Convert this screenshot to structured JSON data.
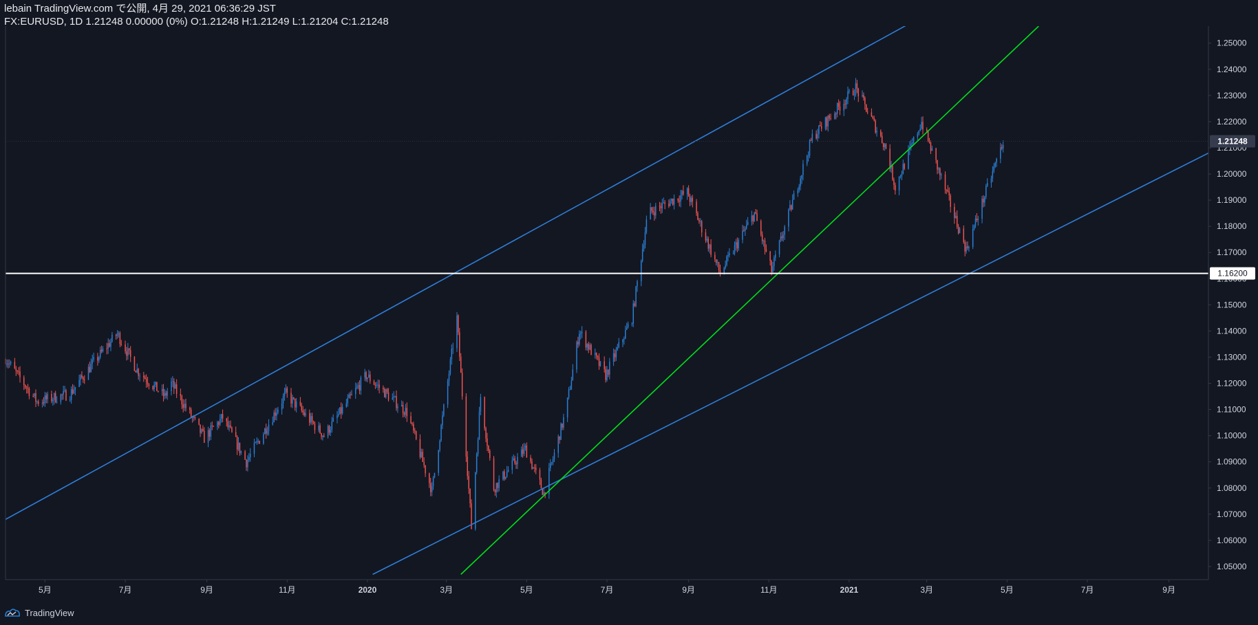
{
  "header": {
    "line1": "lebain TradingView.com で公開, 4月 29, 2021 06:36:29 JST",
    "line2": "FX:EURUSD, 1D 1.21248 0.00000 (0%) O:1.21248 H:1.21249 L:1.21204 C:1.21248"
  },
  "footer": {
    "brand": "TradingView"
  },
  "colors": {
    "background": "#131722",
    "up": "#2a7fd4",
    "down": "#ef5350",
    "channel": "#2f7ed8",
    "trend": "#00e01a",
    "level": "#ffffff",
    "axis_line": "#363a45"
  },
  "chart_data": {
    "type": "candlestick",
    "symbol": "FX:EURUSD",
    "interval": "1D",
    "ylim": [
      1.045,
      1.2565
    ],
    "y_ticks": [
      1.05,
      1.06,
      1.07,
      1.08,
      1.09,
      1.1,
      1.11,
      1.12,
      1.13,
      1.14,
      1.15,
      1.16,
      1.17,
      1.18,
      1.19,
      1.2,
      1.21,
      1.22,
      1.23,
      1.24,
      1.25
    ],
    "y_tick_labels": [
      "1.05000",
      "1.06000",
      "1.07000",
      "1.08000",
      "1.09000",
      "1.10000",
      "1.11000",
      "1.12000",
      "1.13000",
      "1.14000",
      "1.15000",
      "1.16000",
      "1.17000",
      "1.18000",
      "1.19000",
      "1.20000",
      "1.21000",
      "1.22000",
      "1.23000",
      "1.24000",
      "1.25000"
    ],
    "x_range": [
      "2019-04-01",
      "2021-10-01"
    ],
    "x_ticks": [
      {
        "date": "2019-05-01",
        "label": "5月",
        "bold": false
      },
      {
        "date": "2019-07-01",
        "label": "7月",
        "bold": false
      },
      {
        "date": "2019-09-01",
        "label": "9月",
        "bold": false
      },
      {
        "date": "2019-11-01",
        "label": "11月",
        "bold": false
      },
      {
        "date": "2020-01-01",
        "label": "2020",
        "bold": true
      },
      {
        "date": "2020-03-01",
        "label": "3月",
        "bold": false
      },
      {
        "date": "2020-05-01",
        "label": "5月",
        "bold": false
      },
      {
        "date": "2020-07-01",
        "label": "7月",
        "bold": false
      },
      {
        "date": "2020-09-01",
        "label": "9月",
        "bold": false
      },
      {
        "date": "2020-11-01",
        "label": "11月",
        "bold": false
      },
      {
        "date": "2021-01-01",
        "label": "2021",
        "bold": true
      },
      {
        "date": "2021-03-01",
        "label": "3月",
        "bold": false
      },
      {
        "date": "2021-05-01",
        "label": "5月",
        "bold": false
      },
      {
        "date": "2021-07-01",
        "label": "7月",
        "bold": false
      },
      {
        "date": "2021-09-01",
        "label": "9月",
        "bold": false
      }
    ],
    "price_path": [
      [
        "2019-04-01",
        1.1295
      ],
      [
        "2019-04-25",
        1.113
      ],
      [
        "2019-05-20",
        1.116
      ],
      [
        "2019-06-07",
        1.128
      ],
      [
        "2019-06-25",
        1.139
      ],
      [
        "2019-07-10",
        1.125
      ],
      [
        "2019-07-31",
        1.115
      ],
      [
        "2019-08-05",
        1.12
      ],
      [
        "2019-08-30",
        1.099
      ],
      [
        "2019-09-13",
        1.107
      ],
      [
        "2019-10-01",
        1.09
      ],
      [
        "2019-10-31",
        1.116
      ],
      [
        "2019-11-29",
        1.1
      ],
      [
        "2019-12-31",
        1.123
      ],
      [
        "2020-01-31",
        1.109
      ],
      [
        "2020-02-19",
        1.079
      ],
      [
        "2020-03-09",
        1.145
      ],
      [
        "2020-03-20",
        1.065
      ],
      [
        "2020-03-27",
        1.115
      ],
      [
        "2020-04-06",
        1.08
      ],
      [
        "2020-04-30",
        1.095
      ],
      [
        "2020-05-14",
        1.078
      ],
      [
        "2020-05-31",
        1.11
      ],
      [
        "2020-06-10",
        1.14
      ],
      [
        "2020-06-30",
        1.123
      ],
      [
        "2020-07-20",
        1.145
      ],
      [
        "2020-08-01",
        1.185
      ],
      [
        "2020-08-31",
        1.193
      ],
      [
        "2020-09-25",
        1.162
      ],
      [
        "2020-10-21",
        1.185
      ],
      [
        "2020-11-03",
        1.163
      ],
      [
        "2020-12-04",
        1.214
      ],
      [
        "2021-01-06",
        1.233
      ],
      [
        "2021-01-29",
        1.21
      ],
      [
        "2021-02-05",
        1.195
      ],
      [
        "2021-02-25",
        1.22
      ],
      [
        "2021-03-31",
        1.171
      ],
      [
        "2021-04-28",
        1.2125
      ]
    ],
    "last_price": {
      "value": 1.21248,
      "label": "1.21248"
    },
    "drawings": [
      {
        "name": "upper-channel-line",
        "color": "channel",
        "from": [
          "2019-04-01",
          1.068
        ],
        "to": [
          "2021-02-25",
          1.26
        ]
      },
      {
        "name": "lower-channel-line",
        "color": "channel",
        "from": [
          "2020-01-05",
          1.047
        ],
        "to": [
          "2021-10-01",
          1.208
        ]
      },
      {
        "name": "green-trend-line",
        "color": "trend",
        "from": [
          "2020-03-12",
          1.047
        ],
        "to": [
          "2021-05-25",
          1.2565
        ]
      },
      {
        "name": "horizontal-support-line",
        "color": "level",
        "from": [
          "2019-04-01",
          1.162
        ],
        "to": [
          "2021-10-01",
          1.162
        ],
        "label": "1.16200"
      }
    ]
  }
}
